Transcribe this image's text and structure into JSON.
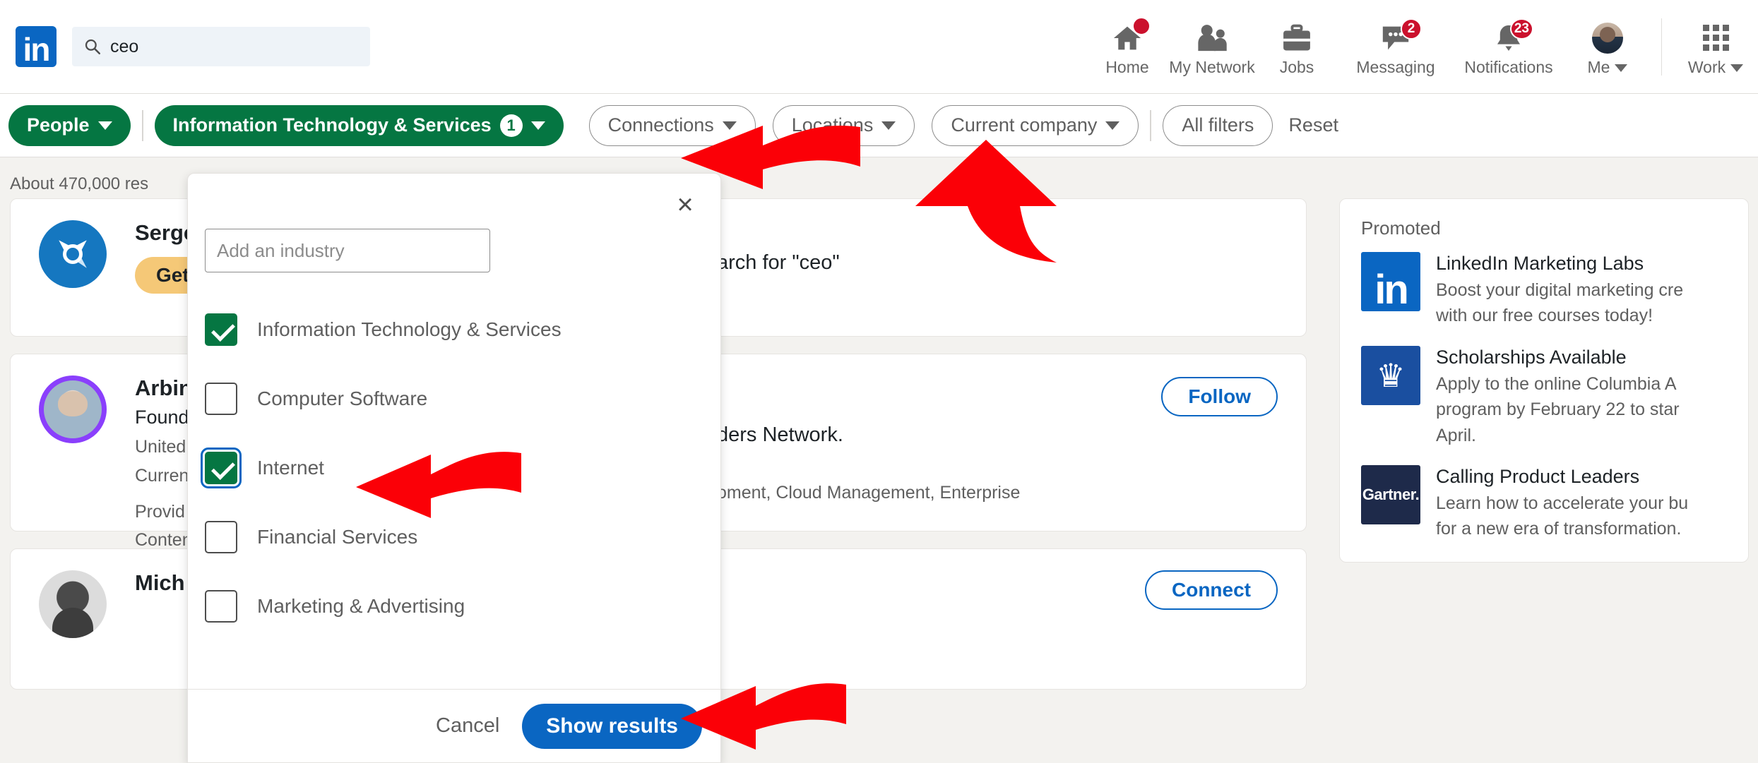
{
  "nav": {
    "logo": "in",
    "search": {
      "value": "ceo",
      "placeholder": "Search",
      "icon": "search-icon"
    },
    "items": [
      {
        "label": "Home",
        "icon": "home-icon",
        "badge": ""
      },
      {
        "label": "My Network",
        "icon": "people-icon",
        "badge": ""
      },
      {
        "label": "Jobs",
        "icon": "briefcase-icon",
        "badge": ""
      },
      {
        "label": "Messaging",
        "icon": "message-icon",
        "badge": "2"
      },
      {
        "label": "Notifications",
        "icon": "bell-icon",
        "badge": "23"
      },
      {
        "label": "Me",
        "icon": "avatar-icon",
        "badge": ""
      },
      {
        "label": "Work",
        "icon": "grid-icon",
        "badge": ""
      }
    ]
  },
  "filterbar": {
    "people": "People",
    "industry": "Information Technology & Services",
    "industry_count": "1",
    "connections": "Connections",
    "locations": "Locations",
    "current_company": "Current company",
    "all_filters": "All filters",
    "reset": "Reset",
    "accent_green": "#057642",
    "accent_blue": "#0a66c2"
  },
  "results": {
    "meta": "About 470,000 res",
    "cards": [
      {
        "name": "Serge",
        "badge": "Get",
        "right_text": "arch for \"ceo\"",
        "avatar": "compass-icon"
      },
      {
        "name": "Arbin",
        "subtitle": "Found",
        "location": "United",
        "current": "Curren",
        "snippet_1": "Provid",
        "snippet_2": "Conten",
        "right_line_1": "ders Network.",
        "right_line_2": "oment, Cloud Management, Enterprise",
        "action": "Follow",
        "avatar": "profile-photo"
      },
      {
        "name": "Mich",
        "action": "Connect",
        "avatar": "profile-photo"
      }
    ]
  },
  "promoted": {
    "title": "Promoted",
    "items": [
      {
        "logo": "in",
        "logo_kind": "linkedin",
        "heading": "LinkedIn Marketing Labs",
        "line1": "Boost your digital marketing cre",
        "line2": "with our free courses today!",
        "line3": ""
      },
      {
        "logo": "♛",
        "logo_kind": "columbia",
        "heading": "Scholarships Available",
        "line1": "Apply to the online Columbia A",
        "line2": "program by February 22 to star",
        "line3": "April."
      },
      {
        "logo": "Gartner.",
        "logo_kind": "gartner",
        "heading": "Calling Product Leaders",
        "line1": "Learn how to accelerate your bu",
        "line2": "for a new era of transformation.",
        "line3": ""
      }
    ]
  },
  "dropdown": {
    "close_icon": "close-icon",
    "input_placeholder": "Add an industry",
    "input_value": "",
    "options": [
      {
        "label": "Information Technology & Services",
        "checked": true,
        "focused": false
      },
      {
        "label": "Computer Software",
        "checked": false,
        "focused": false
      },
      {
        "label": "Internet",
        "checked": true,
        "focused": true
      },
      {
        "label": "Financial Services",
        "checked": false,
        "focused": false
      },
      {
        "label": "Marketing & Advertising",
        "checked": false,
        "focused": false
      }
    ],
    "cancel": "Cancel",
    "show_results": "Show results"
  },
  "annotations": {
    "arrow_color": "#fb0007",
    "arrows": [
      {
        "name": "arrow-to-industry-input",
        "direction": "left"
      },
      {
        "name": "arrow-to-internet-checkbox",
        "direction": "left"
      },
      {
        "name": "arrow-to-show-results",
        "direction": "left"
      },
      {
        "name": "arrow-to-all-filters",
        "direction": "up"
      }
    ]
  }
}
